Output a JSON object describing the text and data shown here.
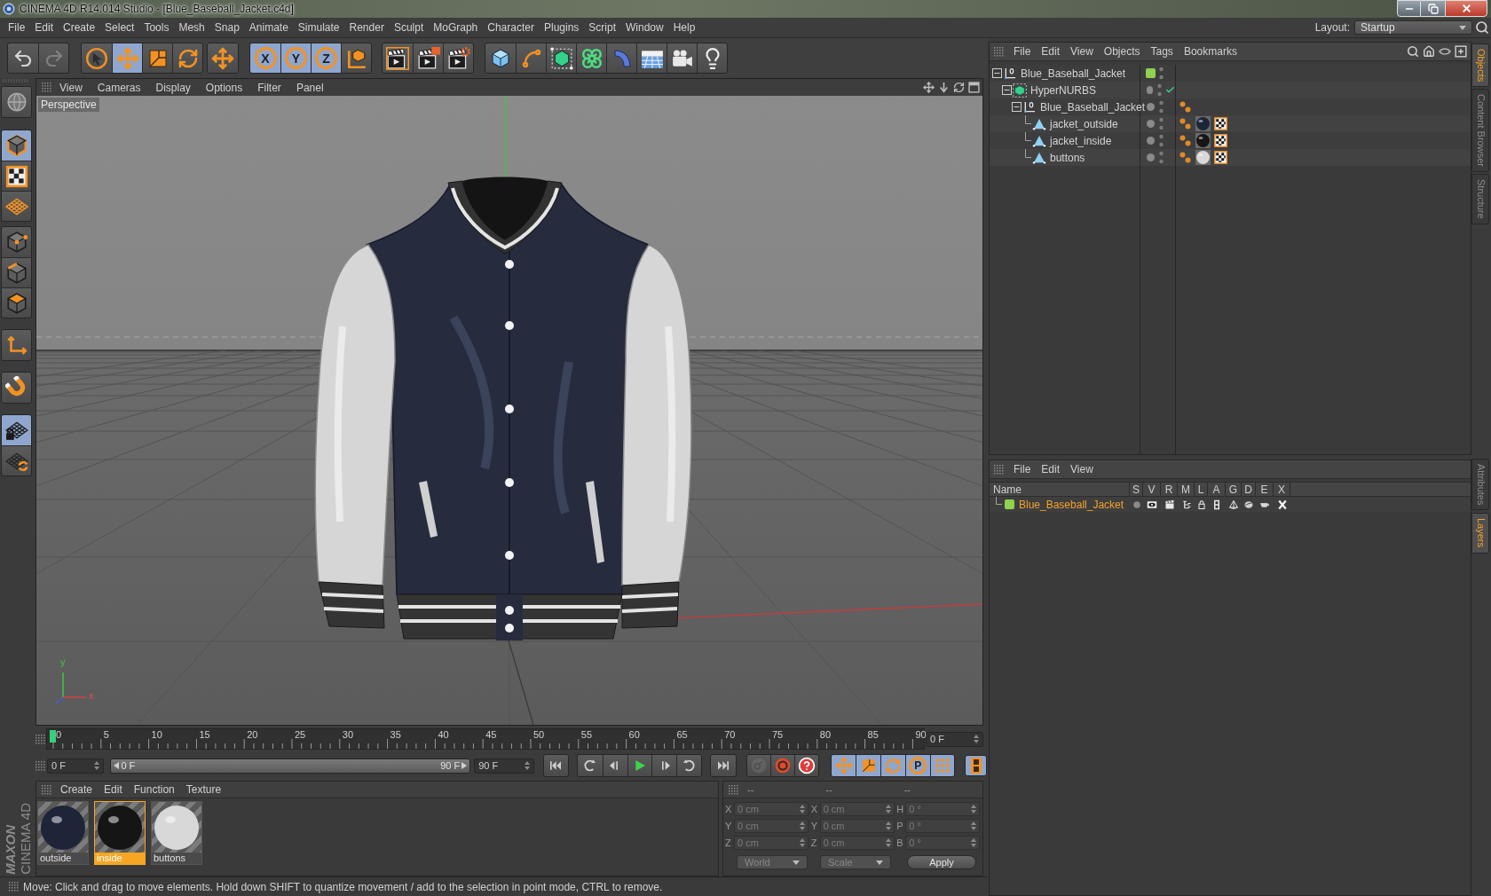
{
  "window": {
    "title": "CINEMA 4D R14.014 Studio - [Blue_Baseball_Jacket.c4d]"
  },
  "menu_bar": [
    "File",
    "Edit",
    "Create",
    "Select",
    "Tools",
    "Mesh",
    "Snap",
    "Animate",
    "Simulate",
    "Render",
    "Sculpt",
    "MoGraph",
    "Character",
    "Plugins",
    "Script",
    "Window",
    "Help"
  ],
  "layout": {
    "label": "Layout:",
    "value": "Startup"
  },
  "toolbar": [
    {
      "buttons": [
        {
          "selected": false,
          "disabled": false
        },
        {
          "selected": false,
          "disabled": true
        }
      ]
    },
    {
      "buttons": [
        {
          "selected": false,
          "disabled": false
        },
        {
          "selected": true,
          "disabled": false
        },
        {
          "selected": false,
          "disabled": false
        },
        {
          "selected": false,
          "disabled": false
        }
      ]
    },
    {
      "buttons": [
        {
          "selected": false,
          "disabled": false
        }
      ]
    },
    {
      "buttons": [
        {
          "label": "X",
          "selected": true,
          "disabled": false
        },
        {
          "label": "Y",
          "selected": true,
          "disabled": false
        },
        {
          "label": "Z",
          "selected": true,
          "disabled": false
        },
        {
          "selected": false,
          "disabled": false
        }
      ]
    },
    {
      "buttons": [
        {
          "selected": false,
          "disabled": false
        },
        {
          "selected": false,
          "disabled": false
        },
        {
          "selected": false,
          "disabled": false
        }
      ]
    },
    {
      "buttons": [
        {
          "selected": false,
          "disabled": false
        },
        {
          "selected": false,
          "disabled": false
        },
        {
          "selected": false,
          "disabled": false
        },
        {
          "selected": false,
          "disabled": false
        },
        {
          "selected": false,
          "disabled": false
        },
        {
          "selected": false,
          "disabled": false
        },
        {
          "selected": false,
          "disabled": false
        },
        {
          "selected": false,
          "disabled": false
        }
      ]
    }
  ],
  "mode_bar": [
    {
      "buttons": [
        {
          "selected": false
        }
      ]
    },
    {
      "buttons": [
        {
          "selected": true
        },
        {
          "selected": false
        },
        {
          "selected": false
        }
      ]
    },
    {
      "buttons": [
        {
          "selected": false
        },
        {
          "selected": false
        },
        {
          "selected": false
        }
      ]
    },
    {
      "buttons": [
        {
          "selected": false
        }
      ]
    },
    {
      "buttons": [
        {
          "selected": false
        }
      ]
    },
    {
      "buttons": [
        {
          "selected": true
        },
        {
          "selected": false
        }
      ]
    }
  ],
  "viewport": {
    "menu": [
      "View",
      "Cameras",
      "Display",
      "Options",
      "Filter",
      "Panel"
    ],
    "camera": "Perspective",
    "axis_labels": [
      "y",
      "x"
    ]
  },
  "timeline": {
    "ticks": [
      "0",
      "5",
      "10",
      "15",
      "20",
      "25",
      "30",
      "35",
      "40",
      "45",
      "50",
      "55",
      "60",
      "65",
      "70",
      "75",
      "80",
      "85",
      "90"
    ],
    "level": 0,
    "frame": "0 F"
  },
  "transport": {
    "start": "0 F",
    "range": {
      "labels": [
        "0 F",
        "90 F"
      ],
      "level": 1
    },
    "end": "90 F",
    "record": [
      {
        "disabled": true
      },
      {
        "disabled": false
      },
      {
        "disabled": false
      }
    ],
    "key_modes": [
      {
        "selected": true
      },
      {
        "selected": true
      },
      {
        "selected": true
      },
      {
        "label": "P",
        "selected": true
      },
      {
        "selected": true
      }
    ]
  },
  "material_manager": {
    "menu": [
      "Create",
      "Edit",
      "Function",
      "Texture"
    ],
    "materials": [
      {
        "name": "outside",
        "selected": false,
        "color": "#1e2538"
      },
      {
        "name": "inside",
        "selected": true,
        "color": "#151515"
      },
      {
        "name": "buttons",
        "selected": false,
        "color": "#d8d8d8"
      }
    ]
  },
  "coordinates": {
    "disabled": true,
    "headers": [
      "--",
      "--",
      "--"
    ],
    "rows": [
      [
        {
          "axis": "X",
          "value": "0 cm"
        },
        {
          "axis": "X",
          "value": "0 cm"
        },
        {
          "axis": "H",
          "value": "0 °"
        }
      ],
      [
        {
          "axis": "Y",
          "value": "0 cm"
        },
        {
          "axis": "Y",
          "value": "0 cm"
        },
        {
          "axis": "P",
          "value": "0 °"
        }
      ],
      [
        {
          "axis": "Z",
          "value": "0 cm"
        },
        {
          "axis": "Z",
          "value": "0 cm"
        },
        {
          "axis": "B",
          "value": "0 °"
        }
      ]
    ],
    "dropdowns": [
      "World",
      "Scale"
    ],
    "apply": "Apply"
  },
  "brand": [
    "MAXON",
    "CINEMA 4D"
  ],
  "status_bar": "Move: Click and drag to move elements. Hold down SHIFT to quantize movement / add to the selection in point mode, CTRL to remove.",
  "object_manager": {
    "menu": [
      "File",
      "Edit",
      "View",
      "Objects",
      "Tags",
      "Bookmarks"
    ],
    "objects": [
      {
        "name": "Blue_Baseball_Jacket",
        "kind": "null",
        "expanded": true,
        "color": "#8ed24e",
        "children": [
          {
            "name": "HyperNURBS",
            "kind": "subdivision",
            "expanded": true,
            "enabled": true,
            "children": [
              {
                "name": "Blue_Baseball_Jacket",
                "kind": "null",
                "expanded": true,
                "tags": [
                  {
                    "kind": "phong"
                  }
                ],
                "children": [
                  {
                    "name": "jacket_outside",
                    "kind": "polygon",
                    "tags": [
                      {
                        "kind": "phong"
                      },
                      {
                        "kind": "material",
                        "color": "#1e2538"
                      },
                      {
                        "kind": "texture"
                      }
                    ]
                  },
                  {
                    "name": "jacket_inside",
                    "kind": "polygon",
                    "tags": [
                      {
                        "kind": "phong"
                      },
                      {
                        "kind": "material",
                        "color": "#151515"
                      },
                      {
                        "kind": "texture"
                      }
                    ]
                  },
                  {
                    "name": "buttons",
                    "kind": "polygon",
                    "tags": [
                      {
                        "kind": "phong"
                      },
                      {
                        "kind": "material",
                        "color": "#d8d8d8"
                      },
                      {
                        "kind": "texture"
                      }
                    ]
                  }
                ]
              }
            ]
          }
        ]
      }
    ]
  },
  "layer_manager": {
    "menu": [
      "File",
      "Edit",
      "View"
    ],
    "columns": [
      "Name",
      "S",
      "V",
      "R",
      "M",
      "L",
      "A",
      "G",
      "D",
      "E",
      "X"
    ],
    "layers": [
      {
        "name": "Blue_Baseball_Jacket",
        "color": "#8ed24e"
      }
    ]
  },
  "side_tabs": {
    "top": [
      {
        "label": "Objects",
        "selected": true
      },
      {
        "label": "Content Browser",
        "selected": false
      },
      {
        "label": "Structure",
        "selected": false
      }
    ],
    "bottom": [
      {
        "label": "Attributes",
        "selected": false
      },
      {
        "label": "Layers",
        "selected": true
      }
    ]
  }
}
